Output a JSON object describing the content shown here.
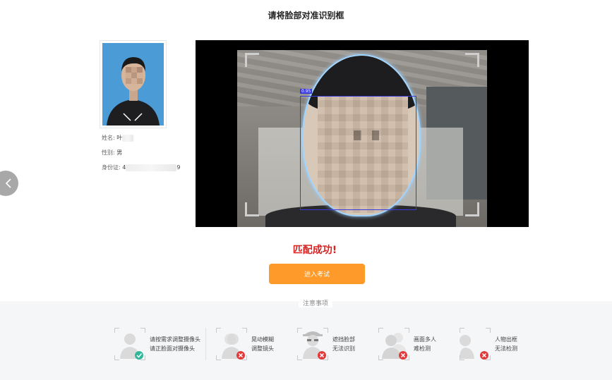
{
  "header": {
    "title": "请将脸部对准识别框"
  },
  "profile": {
    "name_label": "姓名:",
    "name_value": "叶",
    "gender_label": "性别:",
    "gender_value": "男",
    "id_label": "身份证:",
    "id_prefix": "4",
    "id_suffix": "9"
  },
  "camera": {
    "detection_confidence": "0.95"
  },
  "status": {
    "match_text": "匹配成功!"
  },
  "actions": {
    "enter_exam_label": "进入考试"
  },
  "notice": {
    "title": "注意事项",
    "tips": [
      {
        "line1": "请按需求调整摄像头",
        "line2": "请正脸面对摄像头",
        "status": "ok",
        "icon": "person-front-icon"
      },
      {
        "line1": "晃动模糊",
        "line2": "调整镜头",
        "status": "error",
        "icon": "person-blur-icon"
      },
      {
        "line1": "遮挡脸部",
        "line2": "无法识别",
        "status": "error",
        "icon": "person-hat-glasses-icon"
      },
      {
        "line1": "画面多人",
        "line2": "难检测",
        "status": "error",
        "icon": "multiple-people-icon"
      },
      {
        "line1": "人物出框",
        "line2": "无法检测",
        "status": "error",
        "icon": "person-out-of-frame-icon"
      }
    ]
  },
  "colors": {
    "accent_orange": "#fd9a29",
    "success_red_text": "#d92222",
    "ok_badge": "#2fb79a",
    "error_badge": "#e23a3a",
    "detect_box": "#3a3ae0"
  }
}
